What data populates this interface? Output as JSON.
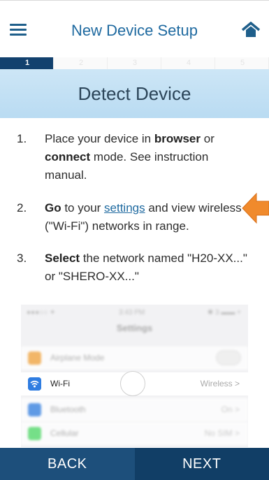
{
  "header": {
    "title": "New Device Setup",
    "menu_icon": "hamburger-menu-icon",
    "home_icon": "home-icon"
  },
  "steps": [
    {
      "label": "1",
      "active": true
    },
    {
      "label": "2",
      "active": false
    },
    {
      "label": "3",
      "active": false
    },
    {
      "label": "4",
      "active": false
    },
    {
      "label": "5",
      "active": false
    }
  ],
  "banner": {
    "title": "Detect Device"
  },
  "instructions": {
    "step1": {
      "num": "1.",
      "t1": "Place your device in ",
      "b1": "browser",
      "t2": " or ",
      "b2": "connect",
      "t3": " mode. See instruction manual."
    },
    "step2": {
      "num": "2.",
      "b1": "Go",
      "t1": " to your ",
      "link": "settings",
      "t2": " and view wireless (\"Wi-Fi\") networks in range."
    },
    "step3": {
      "num": "3.",
      "b1": "Select",
      "t1": " the network named \"H20-XX...\" or \"SHERO-XX...\""
    }
  },
  "screenshot": {
    "carrier": "●●●○○ ✦",
    "time": "3:43 PM",
    "battery": "✱ 3 ▬▬ +",
    "title": "Settings",
    "rows": [
      {
        "label": "Airplane Mode",
        "value": ""
      },
      {
        "label": "Wi-Fi",
        "value": "Wireless >"
      },
      {
        "label": "Bluetooth",
        "value": "On >"
      },
      {
        "label": "Cellular",
        "value": "No SIM >"
      }
    ]
  },
  "footer": {
    "back_label": "BACK",
    "next_label": "NEXT"
  },
  "colors": {
    "accent": "#1f6aa0",
    "nav_dark": "#113e66",
    "banner": "#c4e1f4",
    "arrow": "#f08a2c"
  }
}
